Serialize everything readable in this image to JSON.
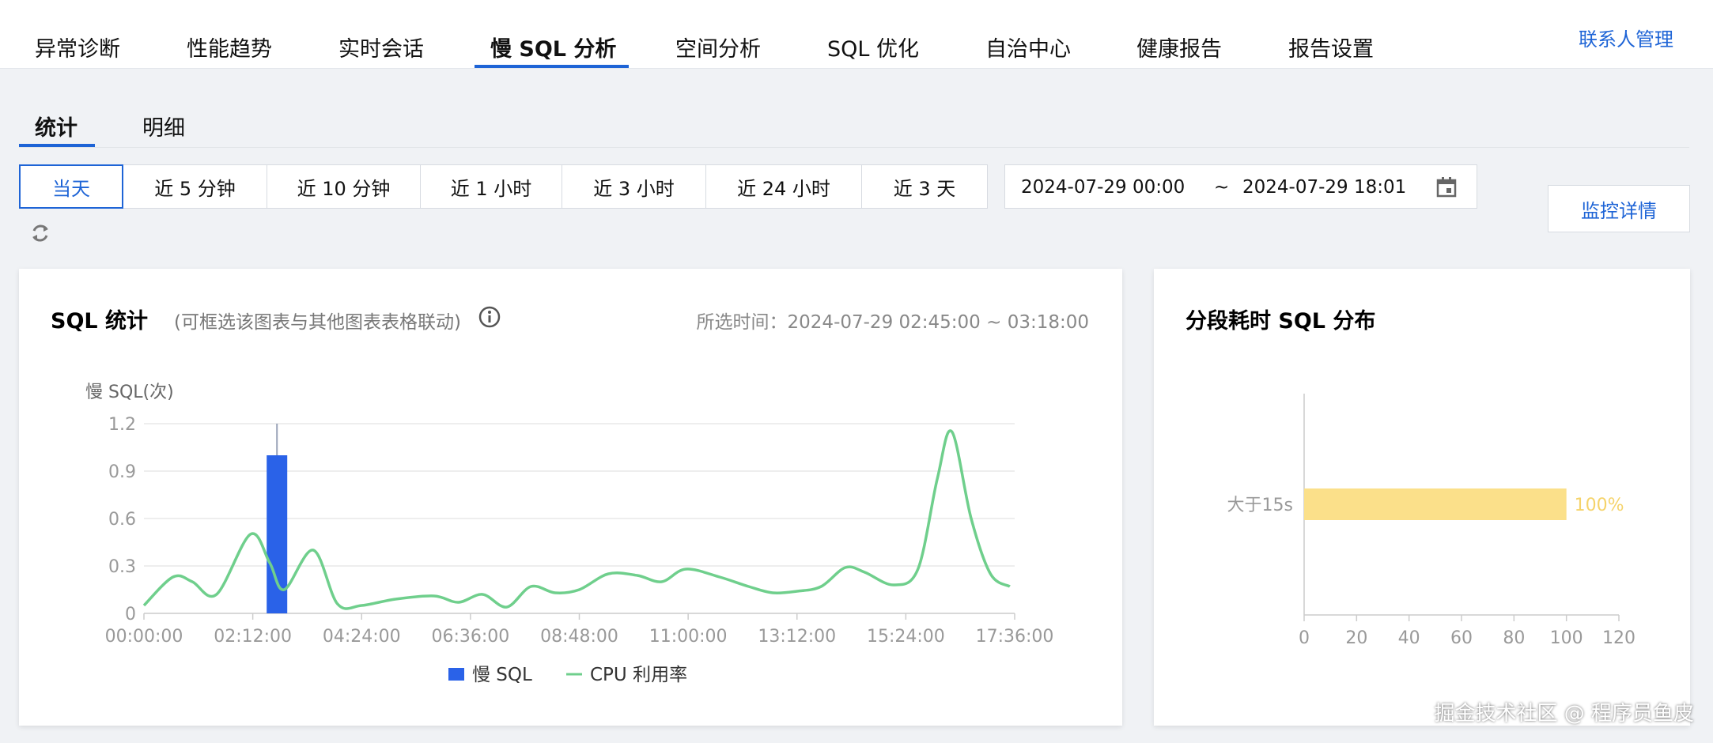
{
  "top_tabs": [
    "异常诊断",
    "性能趋势",
    "实时会话",
    "慢 SQL 分析",
    "空间分析",
    "SQL 优化",
    "自治中心",
    "健康报告",
    "报告设置"
  ],
  "top_active_tab": "慢 SQL 分析",
  "contact_link": "联系人管理",
  "sub_tabs": [
    "统计",
    "明细"
  ],
  "sub_active_tab": "统计",
  "time_buttons": [
    "当天",
    "近 5 分钟",
    "近 10 分钟",
    "近 1 小时",
    "近 3 小时",
    "近 24 小时",
    "近 3 天"
  ],
  "time_active": "当天",
  "date_range": {
    "start": "2024-07-29 00:00",
    "separator": "~",
    "end": "2024-07-29 18:01"
  },
  "monitor_button": "监控详情",
  "sql_card": {
    "title": "SQL 统计",
    "hint": "(可框选该图表与其他图表表格联动)",
    "selected_time": "所选时间：2024-07-29 02:45:00 ~ 03:18:00"
  },
  "dist_card": {
    "title": "分段耗时 SQL 分布"
  },
  "watermark": "掘金技术社区 @ 程序员鱼皮",
  "colors": {
    "accent": "#1e64d6",
    "bar": "#2a62e8",
    "line": "#6fcf8c",
    "dist_bar": "#fbe08a"
  },
  "chart_data": [
    {
      "type": "bar",
      "ylabel": "慢 SQL(次)",
      "ylim": [
        0,
        1.2
      ],
      "yticks": [
        "0",
        "0.3",
        "0.6",
        "0.9",
        "1.2"
      ],
      "xticks": [
        "00:00:00",
        "02:12:00",
        "04:24:00",
        "06:36:00",
        "08:48:00",
        "11:00:00",
        "13:12:00",
        "15:24:00",
        "17:36:00"
      ],
      "x_range_hours": [
        0,
        18
      ],
      "legend": [
        "慢 SQL",
        "CPU 利用率"
      ],
      "legend_position": "bottom-center",
      "bars": [
        {
          "hour": 2.75,
          "value": 1.0
        }
      ],
      "cpu_line": [
        [
          0.0,
          0.05
        ],
        [
          0.6,
          0.23
        ],
        [
          1.0,
          0.2
        ],
        [
          1.5,
          0.12
        ],
        [
          2.2,
          0.5
        ],
        [
          2.6,
          0.32
        ],
        [
          2.9,
          0.15
        ],
        [
          3.5,
          0.4
        ],
        [
          4.0,
          0.06
        ],
        [
          4.5,
          0.05
        ],
        [
          5.2,
          0.09
        ],
        [
          6.0,
          0.11
        ],
        [
          6.5,
          0.07
        ],
        [
          7.0,
          0.12
        ],
        [
          7.5,
          0.04
        ],
        [
          8.0,
          0.17
        ],
        [
          8.5,
          0.13
        ],
        [
          9.0,
          0.15
        ],
        [
          9.6,
          0.25
        ],
        [
          10.2,
          0.24
        ],
        [
          10.7,
          0.2
        ],
        [
          11.2,
          0.28
        ],
        [
          11.9,
          0.23
        ],
        [
          12.5,
          0.17
        ],
        [
          13.0,
          0.13
        ],
        [
          13.5,
          0.14
        ],
        [
          14.0,
          0.17
        ],
        [
          14.5,
          0.29
        ],
        [
          14.9,
          0.26
        ],
        [
          15.5,
          0.18
        ],
        [
          16.0,
          0.28
        ],
        [
          16.4,
          0.85
        ],
        [
          16.7,
          1.15
        ],
        [
          17.1,
          0.6
        ],
        [
          17.5,
          0.25
        ],
        [
          17.9,
          0.17
        ]
      ]
    },
    {
      "type": "bar",
      "orientation": "horizontal",
      "categories": [
        "大于15s"
      ],
      "values": [
        100
      ],
      "labels": [
        "100%"
      ],
      "xlim": [
        0,
        120
      ],
      "xticks": [
        "0",
        "20",
        "40",
        "60",
        "80",
        "100",
        "120"
      ]
    }
  ]
}
